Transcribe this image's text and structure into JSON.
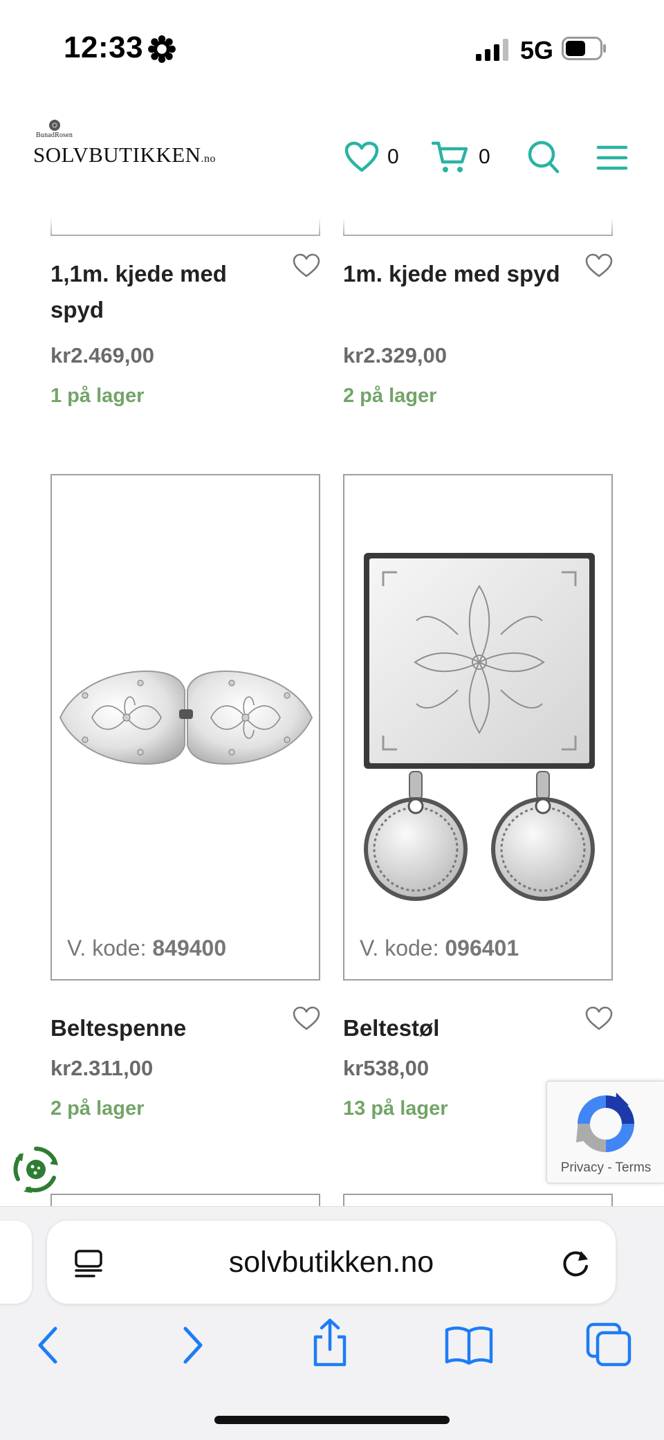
{
  "status_bar": {
    "time": "12:33",
    "network": "5G"
  },
  "header": {
    "logo_small": "BunadRosen",
    "logo_main": "SOLVBUTIKKEN",
    "logo_suffix": ".no",
    "wishlist_count": "0",
    "cart_count": "0"
  },
  "products": [
    {
      "title": "1,1m. kjede med spyd",
      "price": "kr2.469,00",
      "stock": "1 på lager"
    },
    {
      "title": "1m. kjede med spyd",
      "price": "kr2.329,00",
      "stock": "2 på lager"
    },
    {
      "title": "Beltespenne",
      "price": "kr2.311,00",
      "stock": "2 på lager",
      "vkode_label": "V. kode:",
      "vkode": "849400"
    },
    {
      "title": "Beltestøl",
      "price": "kr538,00",
      "stock": "13 på lager",
      "vkode_label": "V. kode:",
      "vkode": "096401"
    }
  ],
  "recaptcha": {
    "privacy": "Privacy",
    "sep": " - ",
    "terms": "Terms"
  },
  "browser": {
    "url": "solvbutikken.no"
  },
  "colors": {
    "accent": "#2ab3a3",
    "stock_green": "#73a468",
    "safari_blue": "#1e7cf5"
  }
}
